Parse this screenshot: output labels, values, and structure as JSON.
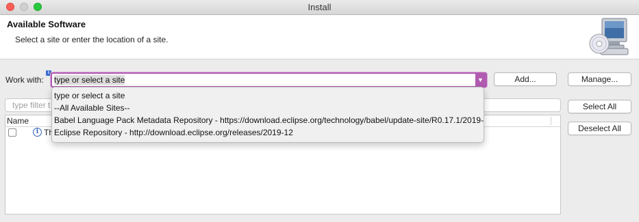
{
  "window": {
    "title": "Install"
  },
  "header": {
    "title": "Available Software",
    "description": "Select a site or enter the location of a site."
  },
  "work_with": {
    "label": "Work with:",
    "value": "type or select a site",
    "info_badge": "i"
  },
  "buttons": {
    "add": "Add...",
    "manage": "Manage...",
    "select_all": "Select All",
    "deselect_all": "Deselect All"
  },
  "filter": {
    "placeholder": "type filter t"
  },
  "table": {
    "column_name": "Name",
    "rows": [
      {
        "info_icon": "i",
        "text": "Th",
        "checked": false
      }
    ]
  },
  "dropdown": {
    "items": [
      "type or select a site",
      "--All Available Sites--",
      "Babel Language Pack Metadata Repository - https://download.eclipse.org/technology/babel/update-site/R0.17.1/2019-",
      "Eclipse Repository - http://download.eclipse.org/releases/2019-12"
    ]
  },
  "icons": {
    "banner": "computer-with-disc-icon",
    "combo_arrow": "chevron-down-icon",
    "info": "info-icon"
  },
  "colors": {
    "accent": "#b15bb1",
    "info_blue": "#2d5fb3"
  }
}
